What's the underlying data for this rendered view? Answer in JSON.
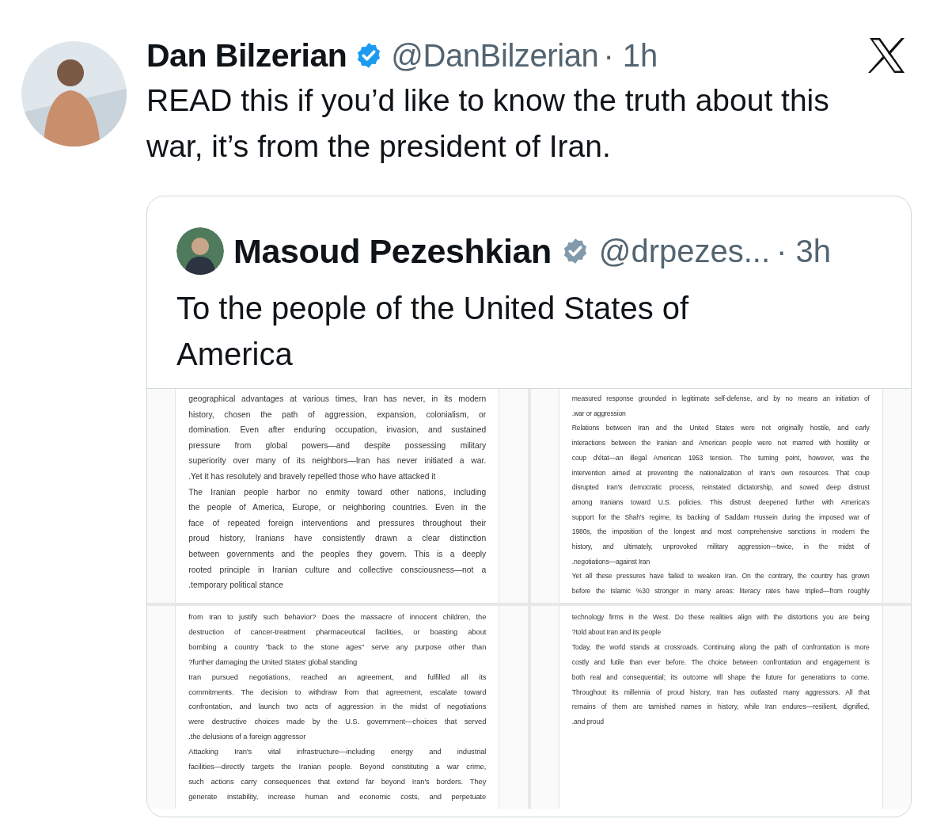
{
  "tweet": {
    "author": {
      "name": "Dan Bilzerian",
      "handle": "@DanBilzerian",
      "time": "· 1h"
    },
    "text": "READ this if you’d like to know the truth about this war, it’s from the president of Iran.",
    "quote": {
      "author": {
        "name": "Masoud Pezeshkian",
        "handle": "@drpezes...",
        "time": "· 3h"
      },
      "text": "To the people of the United States of America",
      "media": [
        {
          "paragraphs": [
            {
              "continues": false,
              "lines": [
                "geographical advantages at various times, Iran has never, in its modern",
                "history, chosen the path of aggression, expansion, colonialism, or",
                "domination. Even after enduring occupation, invasion, and sustained",
                "pressure from global powers—and despite possessing military",
                "superiority over many of its neighbors—Iran has never initiated a war.",
                ".Yet it has resolutely and bravely repelled those who have attacked it"
              ]
            },
            {
              "continues": false,
              "lines": [
                "The Iranian people harbor no enmity toward other nations, including",
                "the people of America, Europe, or neighboring countries. Even in the",
                "face of repeated foreign interventions and pressures throughout their",
                "proud history, Iranians have consistently drawn a clear distinction",
                "between governments and the peoples they govern. This is a deeply",
                "rooted principle in Iranian culture and collective consciousness—not a",
                ".temporary political stance"
              ]
            }
          ]
        },
        {
          "paragraphs": [
            {
              "continues": false,
              "lines": [
                "measured response grounded in legitimate self-defense, and by no means an initiation of",
                ".war or aggression"
              ]
            },
            {
              "continues": false,
              "lines": [
                "Relations between Iran and the United States were not originally hostile, and early",
                "interactions between the Iranian and American people were not marred with hostility or",
                "coup d'état—an illegal American 1953 tension. The turning point, however, was the",
                "intervention aimed at preventing the nationalization of Iran's own resources. That coup",
                "disrupted Iran's democratic process, reinstated dictatorship, and sowed deep distrust",
                "among Iranians toward U.S. policies. This distrust deepened further with America's",
                "support for the Shah's regime, its backing of Saddam Hussein during the imposed war of",
                "1980s, the imposition of the longest and most comprehensive sanctions in modern the",
                "history, and ultimately, unprovoked military aggression—twice, in the midst of",
                ".negotiations—against Iran"
              ]
            },
            {
              "continues": true,
              "lines": [
                "Yet all these pressures have failed to weaken Iran. On the contrary, the country has grown",
                "before the Islamic %30 stronger in many areas: literacy rates have tripled—from roughly"
              ]
            }
          ]
        },
        {
          "paragraphs": [
            {
              "continues": false,
              "lines": [
                "from Iran to justify such behavior? Does the massacre of innocent children, the",
                "destruction of cancer-treatment pharmaceutical facilities, or boasting about",
                "bombing a country \"back to the stone ages\" serve any purpose other than",
                "?further damaging the United States' global standing"
              ]
            },
            {
              "continues": false,
              "lines": [
                "Iran pursued negotiations, reached an agreement, and fulfilled all its",
                "commitments. The decision to withdraw from that agreement, escalate toward",
                "confrontation, and launch two acts of aggression in the midst of negotiations",
                "were destructive choices made by the U.S. government—choices that served",
                ".the delusions of a foreign aggressor"
              ]
            },
            {
              "continues": true,
              "lines": [
                "Attacking Iran's vital infrastructure—including energy and industrial",
                "facilities—directly targets the Iranian people. Beyond constituting a war crime,",
                "such actions carry consequences that extend far beyond Iran's borders. They",
                "generate instability, increase human and economic costs, and perpetuate"
              ]
            }
          ]
        },
        {
          "paragraphs": [
            {
              "continues": false,
              "lines": [
                "technology firms in the West. Do these realities align with the distortions you are being",
                "?told about Iran and its people"
              ]
            },
            {
              "continues": false,
              "lines": [
                "Today, the world stands at crossroads. Continuing along the path of confrontation is more",
                "costly and futile than ever before. The choice between confrontation and engagement is",
                "both real and consequential; its outcome will shape the future for generations to come.",
                "Throughout its millennia of proud history, Iran has outlasted many aggressors. All that",
                "remains of them are tarnished names in history, while Iran endures—resilient, dignified,",
                ".and proud"
              ]
            }
          ]
        }
      ]
    }
  }
}
